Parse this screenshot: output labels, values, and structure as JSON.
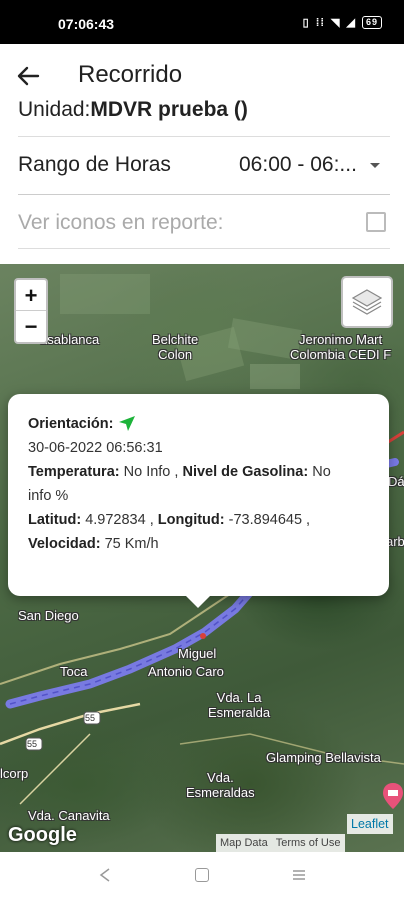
{
  "status_bar": {
    "time": "07:06:43",
    "battery": "69"
  },
  "app_bar": {
    "title": "Recorrido"
  },
  "form": {
    "unit_label": "Unidad:",
    "unit_value": "MDVR prueba ()",
    "range_label": "Rango de Horas",
    "range_value": "06:00 - 06:...",
    "icons_label": "Ver iconos en reporte:",
    "icons_checked": false
  },
  "map": {
    "zoom_in": "+",
    "zoom_out": "−",
    "places": {
      "casablanca": "asablanca",
      "belchite": "Belchite\nColon",
      "jeronimo": "Jeronimo Mart\nColombia CEDI F",
      "dao": "Dá",
      "arb": "arb",
      "san_diego": "San Diego",
      "miguel": "Miguel",
      "toca": "Toca",
      "antonio": "Antonio Caro",
      "esmeralda": "Vda. La\nEsmeralda",
      "glamping": "Glamping Bellavista",
      "esmeraldas": "Vda.\nEsmeraldas",
      "canavita": "Vda. Canavita",
      "corp": "lcorp"
    },
    "road_badge_1": "55",
    "road_badge_2": "55",
    "google_logo": "Google",
    "map_data": "Map Data",
    "terms": "Terms of Use",
    "leaflet": "Leaflet"
  },
  "popup": {
    "orientation_label": "Orientación:",
    "datetime": "30-06-2022 06:56:31",
    "temperature_label": "Temperatura:",
    "temperature_value": "No Info",
    "fuel_label": "Nivel de Gasolina:",
    "fuel_value": "No",
    "fuel_value_cont": "info %",
    "lat_label": "Latitud:",
    "lat_value": "4.972834",
    "lon_label": "Longitud:",
    "lon_value": "-73.894645",
    "speed_label": "Velocidad:",
    "speed_value": "75 Km/h"
  },
  "colors": {
    "route": "#7b7bea",
    "orientation_arrow": "#1db33a"
  }
}
